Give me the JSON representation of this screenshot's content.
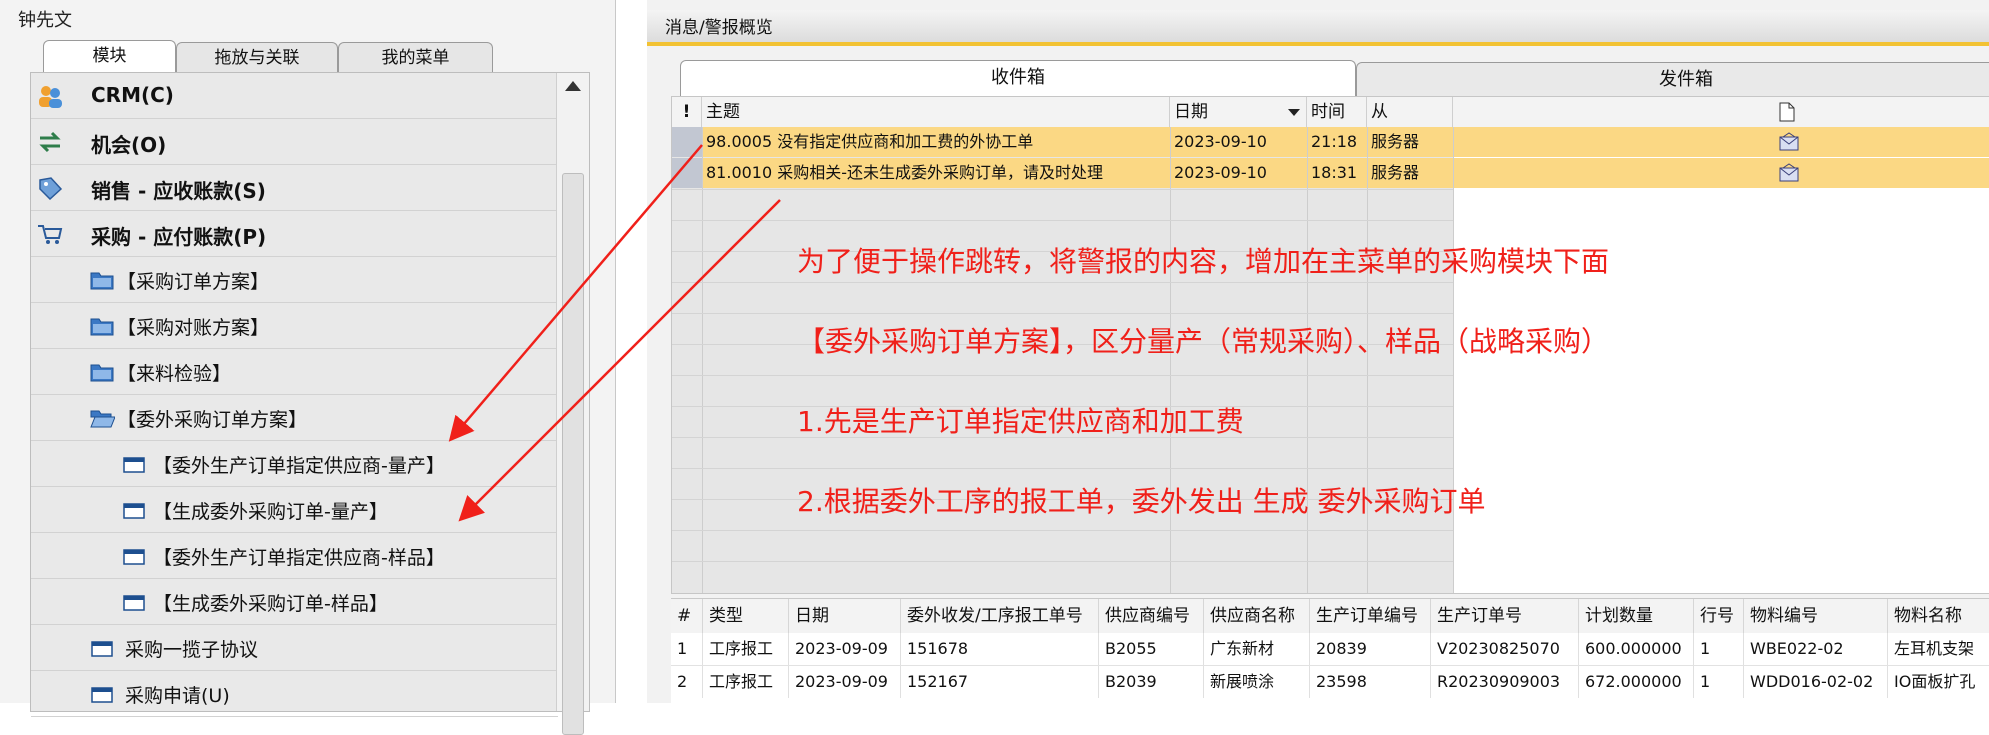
{
  "user": {
    "name": "钟先文"
  },
  "module_tabs": [
    {
      "label": "模块",
      "active": true
    },
    {
      "label": "拖放与关联",
      "active": false
    },
    {
      "label": "我的菜单",
      "active": false
    }
  ],
  "menu": [
    {
      "label": "CRM(C)",
      "icon": "people-icon",
      "level": 0
    },
    {
      "label": "机会(O)",
      "icon": "exchange-icon",
      "level": 0
    },
    {
      "label": "销售 - 应收账款(S)",
      "icon": "tag-icon",
      "level": 0
    },
    {
      "label": "采购 - 应付账款(P)",
      "icon": "cart-icon",
      "level": 0
    },
    {
      "label": "【采购订单方案】",
      "icon": "folder-icon",
      "level": 1
    },
    {
      "label": "【采购对账方案】",
      "icon": "folder-icon",
      "level": 1
    },
    {
      "label": "【来料检验】",
      "icon": "folder-icon",
      "level": 1
    },
    {
      "label": "【委外采购订单方案】",
      "icon": "folder-open-icon",
      "level": 1
    },
    {
      "label": "【委外生产订单指定供应商-量产】",
      "icon": "form-icon",
      "level": 2
    },
    {
      "label": "【生成委外采购订单-量产】",
      "icon": "form-icon",
      "level": 2
    },
    {
      "label": "【委外生产订单指定供应商-样品】",
      "icon": "form-icon",
      "level": 2
    },
    {
      "label": "【生成委外采购订单-样品】",
      "icon": "form-icon",
      "level": 2
    },
    {
      "label": "采购一揽子协议",
      "icon": "form-icon",
      "level": 1
    },
    {
      "label": "采购申请(U)",
      "icon": "form-icon",
      "level": 1
    }
  ],
  "window": {
    "title": "消息/警报概览"
  },
  "mail_tabs": {
    "inbox": "收件箱",
    "outbox": "发件箱"
  },
  "inbox": {
    "columns": {
      "priority": "!",
      "subject": "主题",
      "date": "日期",
      "time": "时间",
      "from": "从"
    },
    "rows": [
      {
        "subject": "98.0005 没有指定供应商和加工费的外协工单",
        "date": "2023-09-10",
        "time": "21:18",
        "from": "服务器"
      },
      {
        "subject": "81.0010 采购相关-还未生成委外采购订单，请及时处理",
        "date": "2023-09-10",
        "time": "18:31",
        "from": "服务器"
      }
    ]
  },
  "annotations": [
    "为了便于操作跳转，将警报的内容，增加在主菜单的采购模块下面",
    "【委外采购订单方案】，区分量产（常规采购）、样品（战略采购）",
    "1.先是生产订单指定供应商和加工费",
    "2.根据委外工序的报工单，委外发出 生成 委外采购订单"
  ],
  "detail_table": {
    "columns": [
      "#",
      "类型",
      "日期",
      "委外收发/工序报工单号",
      "供应商编号",
      "供应商名称",
      "生产订单编号",
      "生产订单号",
      "计划数量",
      "行号",
      "物料编号",
      "物料名称"
    ],
    "rows": [
      [
        "1",
        "工序报工",
        "2023-09-09",
        "151678",
        "B2055",
        "广东新材",
        "20839",
        "V20230825070",
        "600.000000",
        "1",
        "WBE022-02",
        "左耳机支架"
      ],
      [
        "2",
        "工序报工",
        "2023-09-09",
        "152167",
        "B2039",
        "新展喷涂",
        "23598",
        "R20230909003",
        "672.000000",
        "1",
        "WDD016-02-02",
        "IO面板扩孔"
      ]
    ]
  },
  "colors": {
    "highlight_row": "#fbd884",
    "annotation": "#f0201a",
    "title_underline": "#f2c233"
  }
}
